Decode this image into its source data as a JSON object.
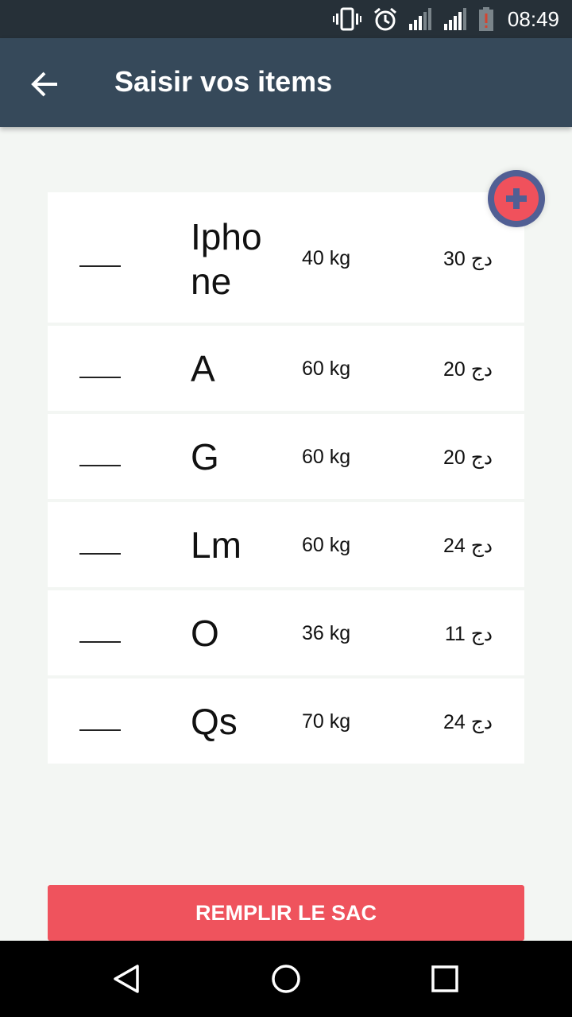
{
  "status_bar": {
    "time": "08:49",
    "icons": [
      "vibrate-icon",
      "alarm-icon",
      "signal-icon",
      "signal-icon",
      "battery-alert-icon"
    ]
  },
  "app_bar": {
    "back_icon": "arrow-back-icon",
    "title": "Saisir vos items"
  },
  "fab": {
    "icon": "plus-icon"
  },
  "items": [
    {
      "marker": "___",
      "name": "Iphone",
      "weight": "40 kg",
      "price": "30 دج"
    },
    {
      "marker": "___",
      "name": "A",
      "weight": "60 kg",
      "price": "20 دج"
    },
    {
      "marker": "___",
      "name": "G",
      "weight": "60 kg",
      "price": "20 دج"
    },
    {
      "marker": "___",
      "name": "Lm",
      "weight": "60 kg",
      "price": "24 دج"
    },
    {
      "marker": "___",
      "name": "O",
      "weight": "36 kg",
      "price": "11 دج"
    },
    {
      "marker": "___",
      "name": "Qs",
      "weight": "70 kg",
      "price": "24 دج"
    }
  ],
  "fill_button": {
    "label": "REMPLIR LE SAC"
  },
  "nav_bar": {
    "icons": [
      "back-triangle-icon",
      "home-circle-icon",
      "recents-square-icon"
    ]
  },
  "colors": {
    "status_bar": "#263038",
    "app_bar": "#36495a",
    "background": "#f3f6f3",
    "accent": "#ef535d",
    "fab_ring": "#515f94"
  }
}
